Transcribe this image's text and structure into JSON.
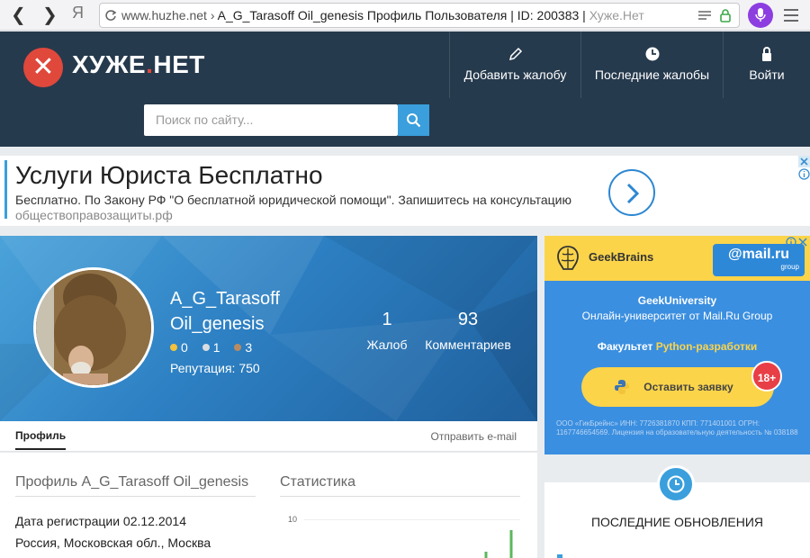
{
  "browser": {
    "url_domain": "www.huzhe.net",
    "url_sep": " › ",
    "url_title": "A_G_Tarasoff Oil_genesis Профиль Пользователя | ID: 200383 | ",
    "url_title_faded": "Хуже.Нет",
    "yandex_glyph": "Я"
  },
  "header": {
    "logo_main": "ХУЖЕ",
    "logo_dot": ".",
    "logo_tail": "НЕТ",
    "nav": [
      {
        "label": "Добавить жалобу",
        "icon": "pencil-icon"
      },
      {
        "label": "Последние жалобы",
        "icon": "clock-icon"
      },
      {
        "label": "Войти",
        "icon": "lock-icon"
      }
    ],
    "search_placeholder": "Поиск по сайту..."
  },
  "ad": {
    "title": "Услуги Юриста Бесплатно",
    "text": "Бесплатно. По Закону РФ \"О бесплатной юридической помощи\". Запишитесь на консультацию",
    "url": "обществоправозащиты.рф"
  },
  "profile": {
    "name_line1": "A_G_Tarasoff",
    "name_line2": "Oil_genesis",
    "medals": [
      {
        "count": "0",
        "color": "#f4c23c"
      },
      {
        "count": "1",
        "color": "#d9dde2"
      },
      {
        "count": "3",
        "color": "#b98b63"
      }
    ],
    "reputation": "Репутация: 750",
    "stats": [
      {
        "num": "1",
        "label": "Жалоб"
      },
      {
        "num": "93",
        "label": "Комментариев"
      }
    ]
  },
  "tabs": {
    "profile": "Профиль",
    "send_email": "Отправить e-mail"
  },
  "content": {
    "profile_title": "Профиль A_G_Tarasoff Oil_genesis",
    "stats_title": "Статистика",
    "reg_date": "Дата регистрации 02.12.2014",
    "location": "Россия, Московская обл., Москва",
    "chart_tick": "10"
  },
  "side_ad": {
    "brand": "GeekBrains",
    "mail_brand": "@mail.ru",
    "mail_sub": "group",
    "uni": "GeekUniversity",
    "online": "Онлайн-университет от Mail.Ru Group",
    "faculty_prefix": "Факультет ",
    "faculty_hl": "Python-разработки",
    "apply": "Оставить заявку",
    "age": "18+",
    "legal": "ООО «ГикБрейнс» ИНН: 7726381870 КПП: 771401001 ОГРН: 1167746654569. Лицензия на образовательную деятельность № 038188"
  },
  "updates": {
    "title": "ПОСЛЕДНИЕ ОБНОВЛЕНИЯ"
  }
}
